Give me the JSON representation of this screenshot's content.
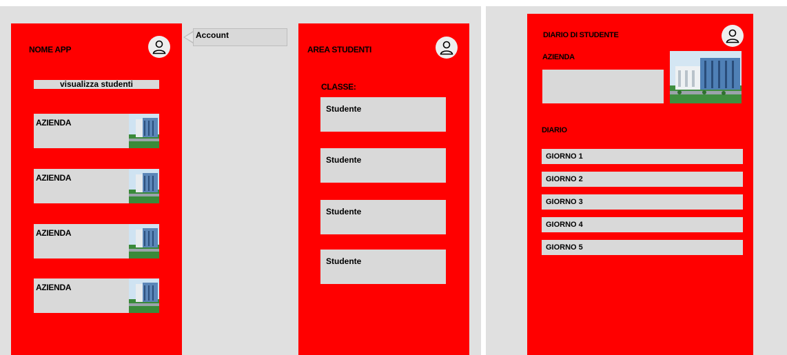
{
  "colors": {
    "canvas": "#e0e0e0",
    "screen": "#ff0000",
    "card": "#d9d9d9",
    "text": "#000000"
  },
  "home": {
    "app_name": "NOME APP",
    "view_students_label": "visualizza studenti",
    "companies": [
      {
        "label": "AZIENDA"
      },
      {
        "label": "AZIENDA"
      },
      {
        "label": "AZIENDA"
      },
      {
        "label": "AZIENDA"
      }
    ],
    "avatar_icon": "user-icon"
  },
  "tooltip": {
    "label": "Account"
  },
  "area": {
    "title": "AREA STUDENTI",
    "class_label": "CLASSE:",
    "students": [
      {
        "label": "Studente"
      },
      {
        "label": "Studente"
      },
      {
        "label": "Studente"
      },
      {
        "label": "Studente"
      }
    ],
    "avatar_icon": "user-icon"
  },
  "diario": {
    "title": "DIARIO DI STUDENTE",
    "company_label": "AZIENDA",
    "section_label": "DIARIO",
    "days": [
      {
        "label": "GIORNO 1"
      },
      {
        "label": "GIORNO 2"
      },
      {
        "label": "GIORNO 3"
      },
      {
        "label": "GIORNO 4"
      },
      {
        "label": "GIORNO 5"
      }
    ],
    "avatar_icon": "user-icon"
  }
}
